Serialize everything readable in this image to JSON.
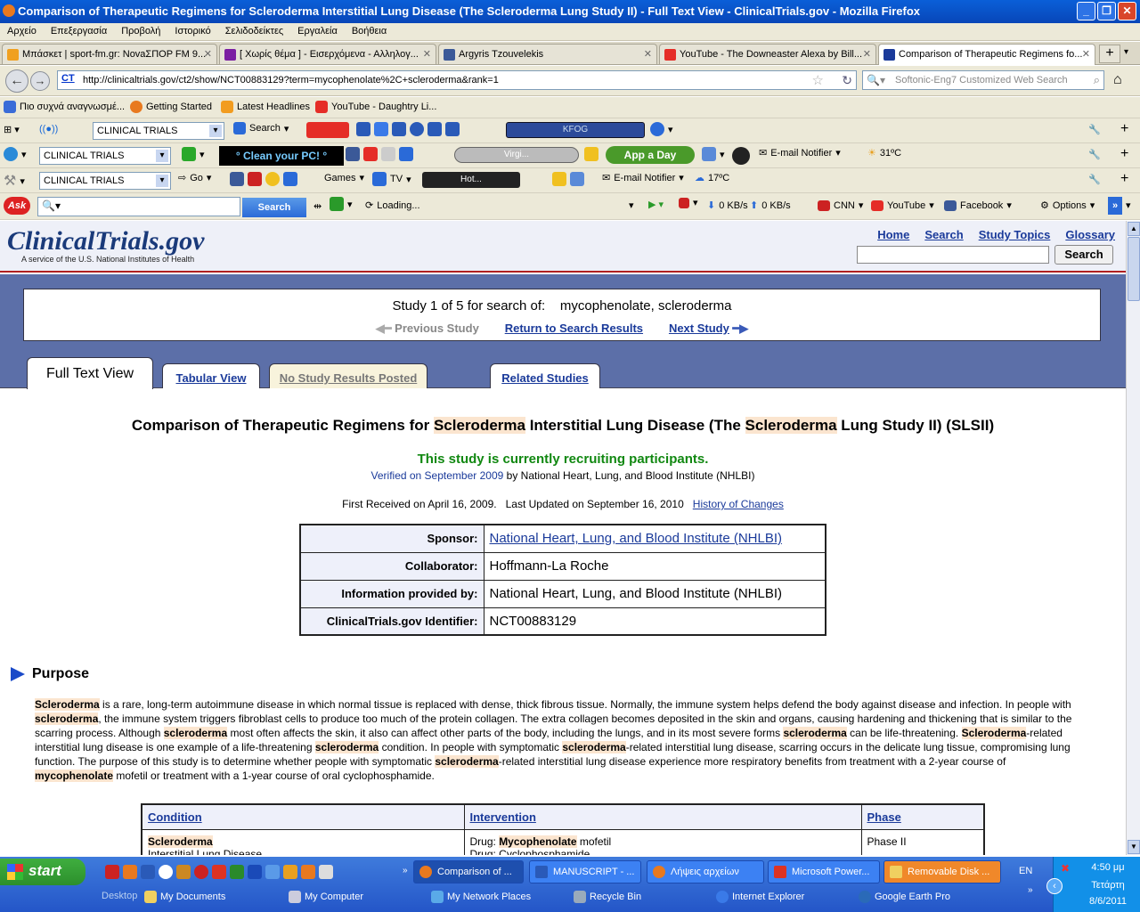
{
  "window": {
    "title": "Comparison of Therapeutic Regimens for Scleroderma Interstitial Lung Disease (The Scleroderma Lung Study II) - Full Text View - ClinicalTrials.gov - Mozilla Firefox"
  },
  "menu": [
    "Αρχείο",
    "Επεξεργασία",
    "Προβολή",
    "Ιστορικό",
    "Σελιδοδείκτες",
    "Εργαλεία",
    "Βοήθεια"
  ],
  "tabs": [
    {
      "label": "Μπάσκετ | sport-fm.gr: ΝοvaΣΠΟΡ FM 9...",
      "color": "#f0a020"
    },
    {
      "label": "[ Χωρίς θέμα ] - Εισερχόμενα - Αλληλογ...",
      "color": "#7b1fa2"
    },
    {
      "label": "Argyris Tzouvelekis",
      "color": "#3b5998"
    },
    {
      "label": "YouTube - The Downeaster Alexa by Bill...",
      "color": "#e52d27"
    },
    {
      "label": "Comparison of Therapeutic Regimens fo...",
      "color": "#1a3a9a"
    }
  ],
  "address": {
    "url": "http://clinicaltrials.gov/ct2/show/NCT00883129?term=mycophenolate%2C+scleroderma&rank=1",
    "site_badge": "CT",
    "search_placeholder": "Softonic-Eng7 Customized Web Search"
  },
  "bookmarks": [
    "Πιο συχνά αναγνωσμέ...",
    "Getting Started",
    "Latest Headlines",
    "YouTube - Daughtry Li..."
  ],
  "toolbar1": {
    "dropdown": "CLINICAL TRIALS",
    "search_label": "Search",
    "radio": "KFOG"
  },
  "toolbar2": {
    "dropdown": "CLINICAL TRIALS",
    "promo": "° Clean your PC! °",
    "radio": "Virgi...",
    "app_button": "App a Day",
    "notifier": "E-mail Notifier",
    "temp": "31ºC"
  },
  "toolbar3": {
    "dropdown": "CLINICAL TRIALS",
    "go": "Go",
    "games": "Games",
    "tv": "TV",
    "radio": "Hot...",
    "notifier": "E-mail Notifier",
    "temp": "17ºC"
  },
  "toolbar4": {
    "search_button": "Search",
    "loading": "Loading...",
    "down": "0 KB/s",
    "up": "0 KB/s",
    "cnn": "CNN",
    "youtube": "YouTube",
    "facebook": "Facebook",
    "options": "Options"
  },
  "site": {
    "logo": "ClinicalTrials.gov",
    "logo_sub": "A service of the U.S. National Institutes of Health",
    "nav": [
      "Home",
      "Search",
      "Study Topics",
      "Glossary"
    ],
    "search_button": "Search"
  },
  "study_nav": {
    "counter": "Study 1 of 5 for search of:",
    "query": "mycophenolate, scleroderma",
    "prev": "Previous Study",
    "return": "Return to Search Results",
    "next": "Next Study"
  },
  "page_tabs": {
    "full": "Full Text View",
    "tabular": "Tabular View",
    "results": "No Study Results Posted",
    "related": "Related Studies"
  },
  "study": {
    "title_parts": [
      "Comparison of Therapeutic Regimens for ",
      "Scleroderma",
      " Interstitial Lung Disease (The ",
      "Scleroderma",
      " Lung Study II) (SLSII)"
    ],
    "status": "This study is currently recruiting participants.",
    "verified": "Verified on September 2009",
    "verified_by": "by National Heart, Lung, and Blood Institute (NHLBI)",
    "first_received": "First Received on April 16, 2009.",
    "last_updated": "Last Updated on September 16, 2010",
    "history": "History of Changes",
    "info": [
      {
        "key": "Sponsor:",
        "value": "National Heart, Lung, and Blood Institute (NHLBI)"
      },
      {
        "key": "Collaborator:",
        "value": "Hoffmann-La Roche"
      },
      {
        "key": "Information provided by:",
        "value": "National Heart, Lung, and Blood Institute (NHLBI)"
      },
      {
        "key": "ClinicalTrials.gov Identifier:",
        "value": "NCT00883129"
      }
    ]
  },
  "purpose": {
    "heading": "Purpose",
    "segments": [
      [
        "b",
        "Scleroderma"
      ],
      [
        "t",
        " is a rare, long-term autoimmune disease in which normal tissue is replaced with dense, thick fibrous tissue. Normally, the immune system helps defend the body against disease and infection. In people with "
      ],
      [
        "b",
        "scleroderma"
      ],
      [
        "t",
        ", the immune system triggers fibroblast cells to produce too much of the protein collagen. The extra collagen becomes deposited in the skin and organs, causing hardening and thickening that is similar to the scarring process. Although "
      ],
      [
        "b",
        "scleroderma"
      ],
      [
        "t",
        " most often affects the skin, it also can affect other parts of the body, including the lungs, and in its most severe forms "
      ],
      [
        "b",
        "scleroderma"
      ],
      [
        "t",
        " can be life-threatening. "
      ],
      [
        "b",
        "Scleroderma"
      ],
      [
        "t",
        "-related interstitial lung disease is one example of a life-threatening "
      ],
      [
        "b",
        "scleroderma"
      ],
      [
        "t",
        " condition. In people with symptomatic "
      ],
      [
        "b",
        "scleroderma"
      ],
      [
        "t",
        "-related interstitial lung disease, scarring occurs in the delicate lung tissue, compromising lung function. The purpose of this study is to determine whether people with symptomatic "
      ],
      [
        "b",
        "scleroderma"
      ],
      [
        "t",
        "-related interstitial lung disease experience more respiratory benefits from treatment with a 2-year course of "
      ],
      [
        "b",
        "mycophenolate"
      ],
      [
        "t",
        " mofetil or treatment with a 1-year course of oral cyclophosphamide."
      ]
    ]
  },
  "conditions_table": {
    "headers": [
      "Condition",
      "Intervention",
      "Phase"
    ],
    "row": {
      "condition": "Scleroderma",
      "condition2": "Interstitial Lung Disease",
      "drug_prefix": "Drug: ",
      "drug": "Mycophenolate",
      "drug_suffix": " mofetil",
      "drug2": "Drug: Cyclophosphamide",
      "phase": "Phase II"
    }
  },
  "taskbar": {
    "start": "start",
    "tasks": [
      "Comparison of ...",
      "MANUSCRIPT - ...",
      "Λήψεις αρχείων",
      "Microsoft Power...",
      "Removable Disk ..."
    ],
    "lang": "EN",
    "time": "4:50 μμ",
    "day": "Τετάρτη",
    "date": "8/6/2011",
    "quicklinks": [
      "Desktop",
      "My Documents",
      "My Computer",
      "My Network Places",
      "Recycle Bin",
      "Internet Explorer",
      "Google Earth Pro"
    ]
  }
}
